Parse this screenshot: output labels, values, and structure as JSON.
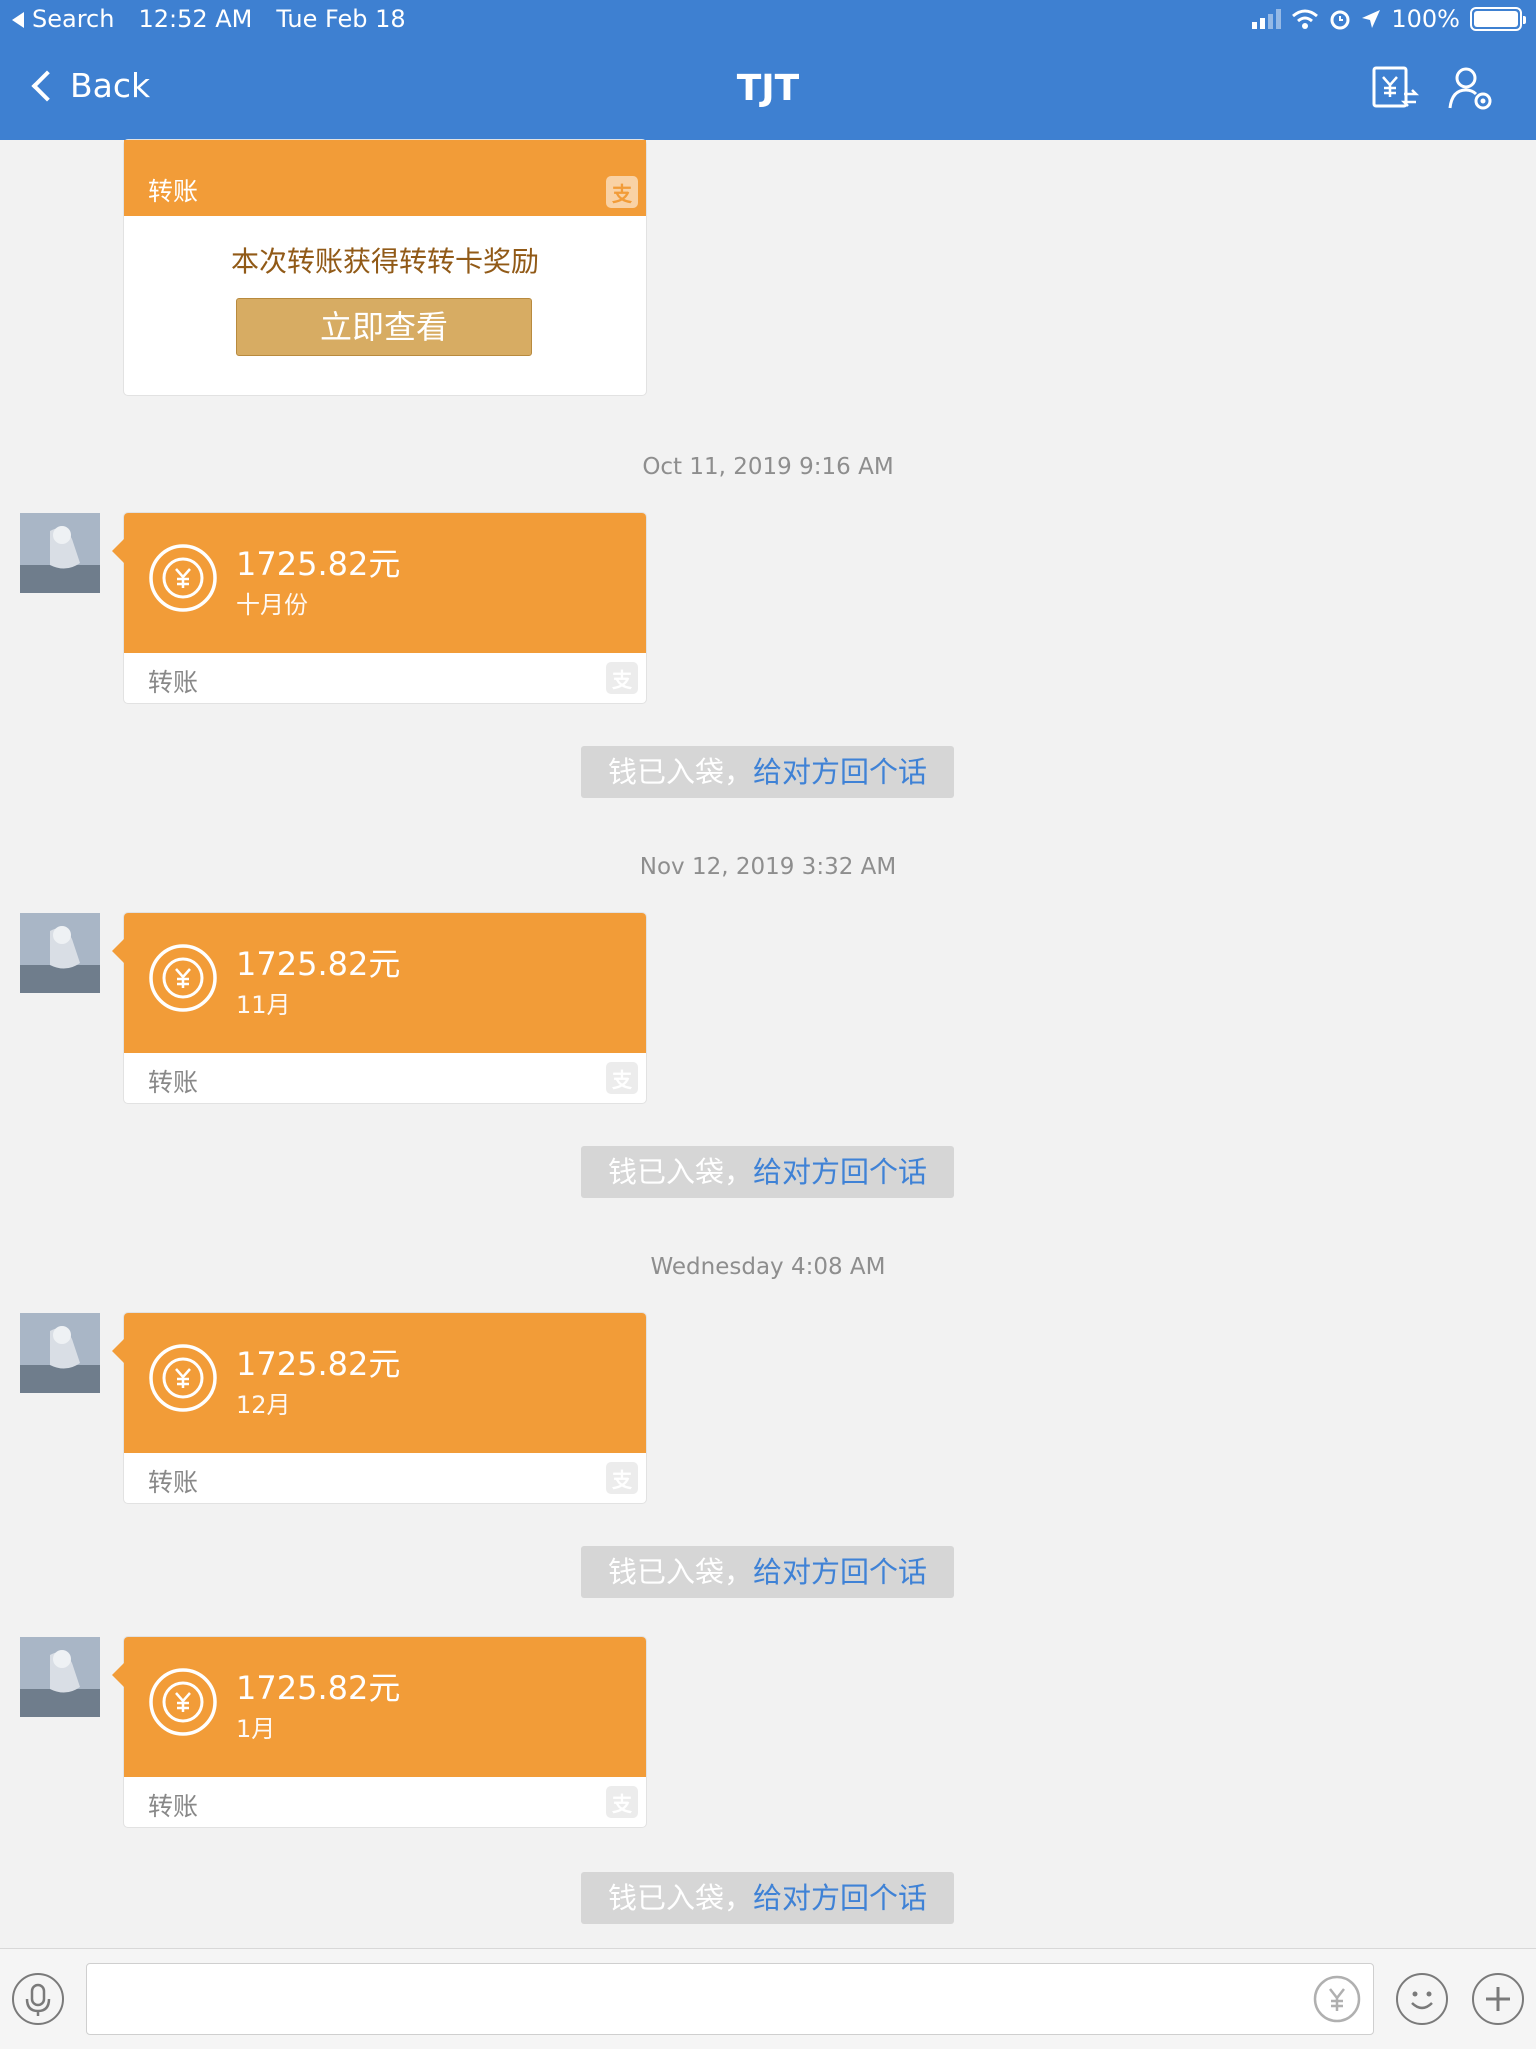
{
  "status_bar": {
    "back_app": "Search",
    "time": "12:52 AM",
    "date": "Tue Feb 18",
    "battery": "100%"
  },
  "nav": {
    "back_label": "Back",
    "title": "TJT"
  },
  "reward_card": {
    "header": "转账",
    "message": "本次转账获得转转卡奖励",
    "button": "立即查看"
  },
  "messages": [
    {
      "timestamp": "Oct 11, 2019 9:16 AM",
      "amount": "1725.82元",
      "note": "十月份",
      "label": "转账"
    },
    {
      "timestamp": "Nov 12, 2019 3:32 AM",
      "amount": "1725.82元",
      "note": "11月",
      "label": "转账"
    },
    {
      "timestamp": "Wednesday 4:08 AM",
      "amount": "1725.82元",
      "note": "12月",
      "label": "转账"
    },
    {
      "timestamp": "",
      "amount": "1725.82元",
      "note": "1月",
      "label": "转账"
    }
  ],
  "received_notice": {
    "prefix": "钱已入袋，",
    "link": "给对方回个话"
  },
  "input": {
    "placeholder": "",
    "value": ""
  },
  "colors": {
    "nav_bg": "#3e80d1",
    "transfer_orange": "#f29c38",
    "button_gold": "#d7ac63",
    "link_blue": "#3f82d6"
  },
  "icons": [
    "back-chevron-icon",
    "transfer-yen-icon",
    "contact-settings-icon",
    "yen-coin-icon",
    "alipay-icon",
    "microphone-icon",
    "emoji-icon",
    "plus-icon"
  ]
}
